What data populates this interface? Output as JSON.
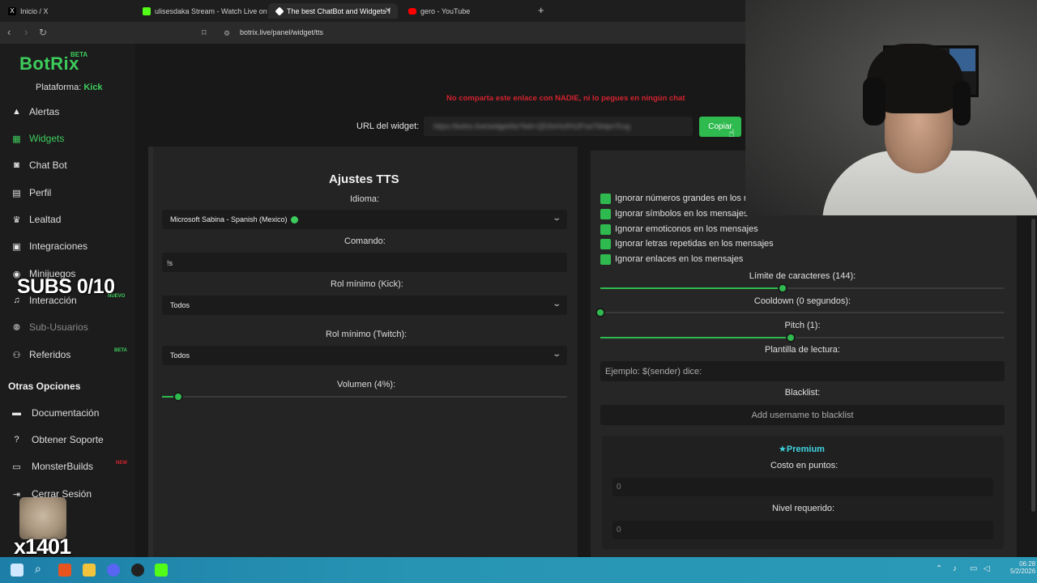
{
  "browser": {
    "tabs": [
      {
        "label": "Inicio / X",
        "color": "#000000"
      },
      {
        "label": "ulisesdaka Stream - Watch Live on Ki",
        "color": "#53fc18"
      },
      {
        "label": "The best ChatBot and Widgets f",
        "color": "#ffffff"
      },
      {
        "label": "gero - YouTube",
        "color": "#ff0000"
      }
    ],
    "new_tab": "+",
    "url": "botrix.live/panel/widget/tts"
  },
  "sidebar": {
    "logo": "BotRix",
    "logo_badge": "BETA",
    "platform_label": "Plataforma:",
    "platform_value": "Kick",
    "items": [
      {
        "label": "Alertas",
        "icon": "warning-icon"
      },
      {
        "label": "Widgets",
        "icon": "grid-icon"
      },
      {
        "label": "Chat Bot",
        "icon": "robot-icon"
      },
      {
        "label": "Perfil",
        "icon": "id-card-icon"
      },
      {
        "label": "Lealtad",
        "icon": "trophy-icon"
      },
      {
        "label": "Integraciones",
        "icon": "plug-icon"
      },
      {
        "label": "Minijuegos",
        "icon": "gamepad-icon"
      },
      {
        "label": "Interacción",
        "icon": "music-icon",
        "badge": "NUEVO"
      },
      {
        "label": "Sub-Usuarios",
        "icon": "users-icon"
      },
      {
        "label": "Referidos",
        "icon": "user-group-icon",
        "badge": "BETA"
      }
    ],
    "other_title": "Otras Opciones",
    "other_items": [
      {
        "label": "Documentación",
        "icon": "book-icon"
      },
      {
        "label": "Obtener Soporte",
        "icon": "question-icon"
      },
      {
        "label": "MonsterBuilds",
        "icon": "monitor-icon",
        "badge": "NEW"
      },
      {
        "label": "Cerrar Sesión",
        "icon": "logout-icon"
      }
    ]
  },
  "overlay": {
    "subs": "SUBS 0/10",
    "multiplier": "x1401"
  },
  "widget": {
    "warning": "No comparta este enlace con NADIE, ni lo pegues en ningún chat",
    "url_label": "URL del widget:",
    "url_value": "https://botrix.live/widget/tts?bid=QD3nHu5%2Fsa7WdpnTcxg",
    "copy_label": "Copiar"
  },
  "tts": {
    "title": "Ajustes TTS",
    "language_label": "Idioma:",
    "language_value": "Microsoft Sabina - Spanish (Mexico)",
    "command_label": "Comando:",
    "command_value": "!s",
    "role_kick_label": "Rol mínimo (Kick):",
    "role_kick_value": "Todos",
    "role_twitch_label": "Rol mínimo (Twitch):",
    "role_twitch_value": "Todos",
    "volume_label": "Volumen (4%):",
    "volume": 0.04
  },
  "options": {
    "checkboxes": [
      "Ignorar números grandes en los m",
      "Ignorar símbolos en los mensajes",
      "Ignorar emoticonos en los mensajes",
      "Ignorar letras repetidas en los mensajes",
      "Ignorar enlaces en los mensajes"
    ],
    "char_limit_label": "Límite de caracteres (144):",
    "char_limit_fraction": 0.45,
    "cooldown_label": "Cooldown (0 segundos):",
    "cooldown_fraction": 0,
    "pitch_label": "Pitch (1):",
    "pitch_fraction": 0.47,
    "template_label": "Plantilla de lectura:",
    "template_placeholder": "Ejemplo: $(sender) dice:",
    "blacklist_label": "Blacklist:",
    "blacklist_placeholder": "Add username to blacklist",
    "premium_title": "Premium",
    "points_label": "Costo en puntos:",
    "points_value": "0",
    "level_label": "Nivel requerido:",
    "level_value": "0"
  },
  "taskbar": {
    "time": "06:28",
    "date": "5/2/2026"
  }
}
